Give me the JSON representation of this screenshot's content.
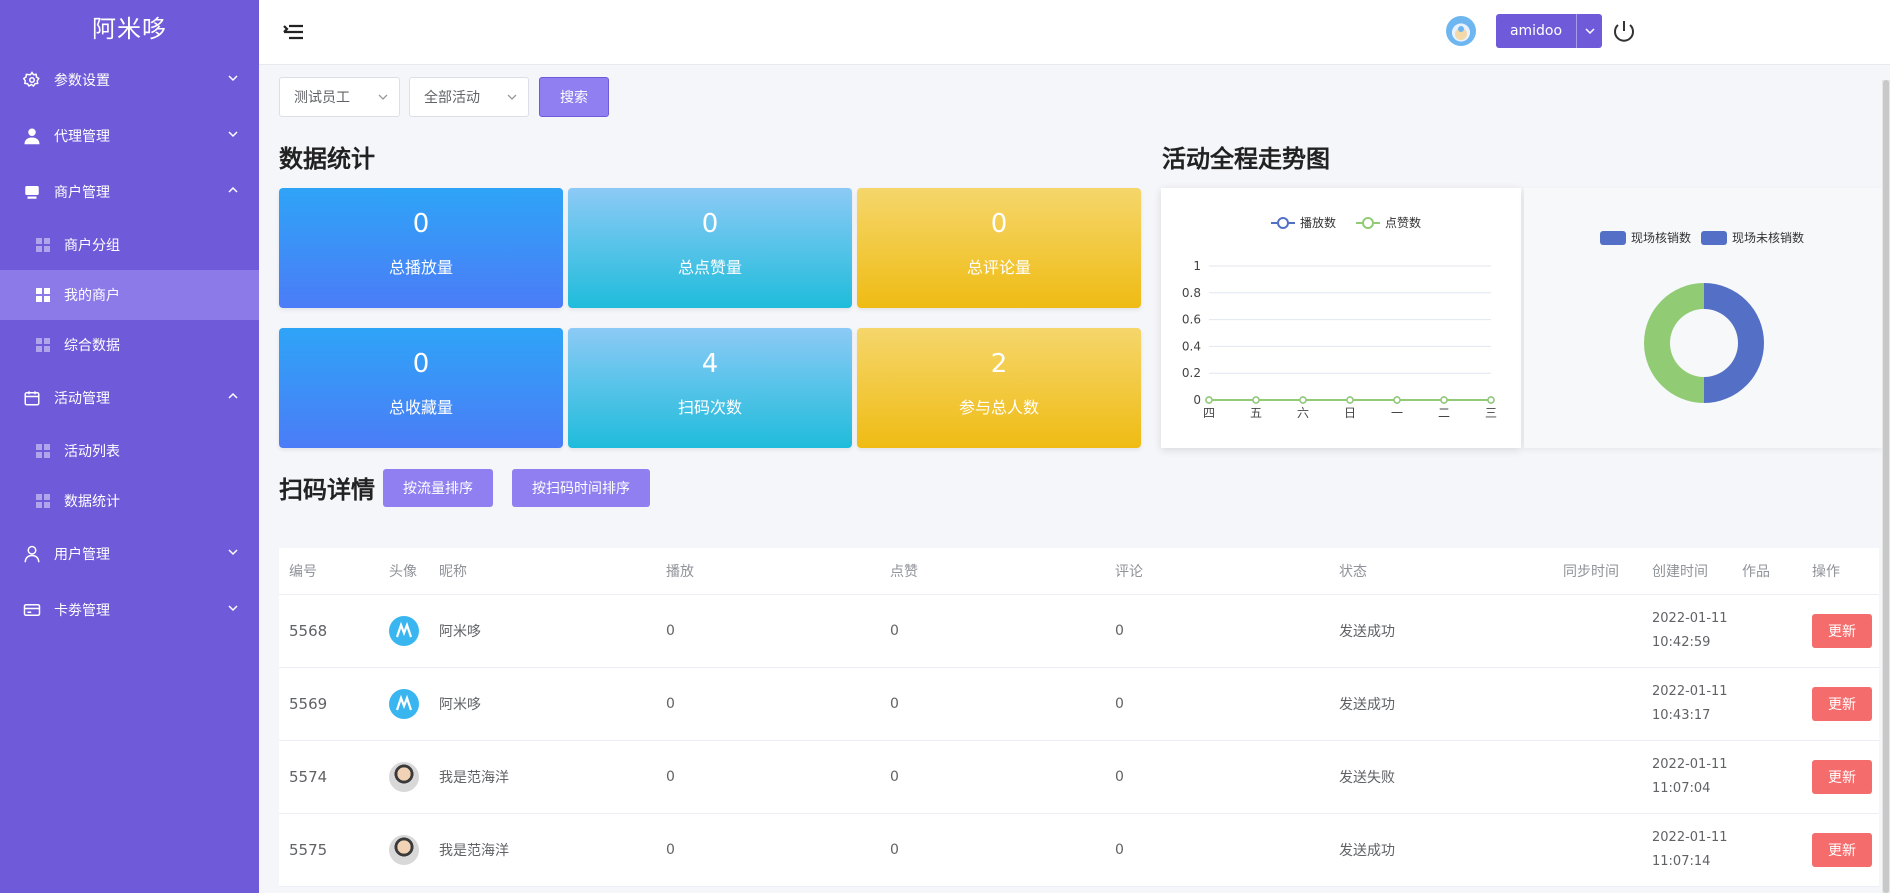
{
  "sidebar": {
    "brand": "阿米哆",
    "menu": [
      {
        "label": "参数设置"
      },
      {
        "label": "代理管理"
      },
      {
        "label": "商户管理"
      },
      {
        "label": "活动管理"
      },
      {
        "label": "用户管理"
      },
      {
        "label": "卡劵管理"
      }
    ],
    "merchant_sub": [
      {
        "label": "商户分组"
      },
      {
        "label": "我的商户"
      },
      {
        "label": "综合数据"
      }
    ],
    "activity_sub": [
      {
        "label": "活动列表"
      },
      {
        "label": "数据统计"
      }
    ]
  },
  "header": {
    "username": "amidoo"
  },
  "filters": {
    "employee": "测试员工",
    "activity": "全部活动",
    "search_label": "搜索"
  },
  "stats": {
    "title": "数据统计",
    "cards": [
      {
        "value": "0",
        "label": "总播放量"
      },
      {
        "value": "0",
        "label": "总点赞量"
      },
      {
        "value": "0",
        "label": "总评论量"
      },
      {
        "value": "0",
        "label": "总收藏量"
      },
      {
        "value": "4",
        "label": "扫码次数"
      },
      {
        "value": "2",
        "label": "参与总人数"
      }
    ]
  },
  "trend": {
    "title": "活动全程走势图"
  },
  "chart_data": [
    {
      "type": "line",
      "categories": [
        "四",
        "五",
        "六",
        "日",
        "一",
        "二",
        "三"
      ],
      "series": [
        {
          "name": "播放数",
          "values": [
            0,
            0,
            0,
            0,
            0,
            0,
            0
          ],
          "color": "#5470c6"
        },
        {
          "name": "点赞数",
          "values": [
            0,
            0,
            0,
            0,
            0,
            0,
            0
          ],
          "color": "#91cc75"
        }
      ],
      "ylim": [
        0,
        1
      ],
      "yticks": [
        "1",
        "0.8",
        "0.6",
        "0.4",
        "0.2",
        "0"
      ],
      "legend": "top-center",
      "grid": true
    },
    {
      "type": "pie",
      "donut": true,
      "legend": "top-center",
      "slices": [
        {
          "name": "现场核销数",
          "value": 1,
          "color": "#5470c6"
        },
        {
          "name": "现场未核销数",
          "value": 1,
          "color": "#91cc75"
        }
      ],
      "legend_colors": [
        "#5470c6",
        "#5470c6"
      ]
    }
  ],
  "scan": {
    "title": "扫码详情",
    "sort_traffic": "按流量排序",
    "sort_time": "按扫码时间排序",
    "columns": [
      "编号",
      "头像",
      "昵称",
      "播放",
      "点赞",
      "评论",
      "状态",
      "同步时间",
      "创建时间",
      "作品",
      "操作"
    ],
    "rows": [
      {
        "id": "5568",
        "avatar": "logo",
        "nickname": "阿米哆",
        "play": "0",
        "like": "0",
        "comment": "0",
        "status": "发送成功",
        "date": "2022-01-11",
        "time": "10:42:59",
        "action": "更新"
      },
      {
        "id": "5569",
        "avatar": "logo",
        "nickname": "阿米哆",
        "play": "0",
        "like": "0",
        "comment": "0",
        "status": "发送成功",
        "date": "2022-01-11",
        "time": "10:43:17",
        "action": "更新"
      },
      {
        "id": "5574",
        "avatar": "face",
        "nickname": "我是范海洋",
        "play": "0",
        "like": "0",
        "comment": "0",
        "status": "发送失败",
        "date": "2022-01-11",
        "time": "11:07:04",
        "action": "更新"
      },
      {
        "id": "5575",
        "avatar": "face",
        "nickname": "我是范海洋",
        "play": "0",
        "like": "0",
        "comment": "0",
        "status": "发送成功",
        "date": "2022-01-11",
        "time": "11:07:14",
        "action": "更新"
      }
    ]
  }
}
